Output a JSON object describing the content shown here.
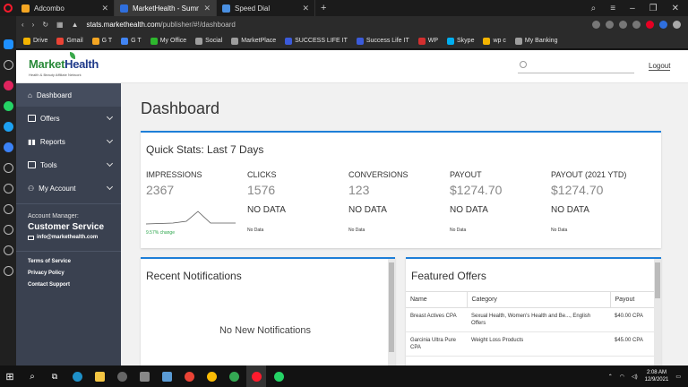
{
  "browser": {
    "tabs": [
      {
        "title": "Adcombo",
        "active": false,
        "color": "#f5a623"
      },
      {
        "title": "MarketHealth - Summary R",
        "active": true,
        "color": "#2f6fde"
      },
      {
        "title": "Speed Dial",
        "active": false,
        "color": "#4a90e2"
      }
    ],
    "url_host": "stats.markethealth.com",
    "url_path": "/publisher/#!/dashboard",
    "bookmarks": [
      {
        "label": "Drive",
        "color": "#f4b400"
      },
      {
        "label": "Gmail",
        "color": "#ea4335"
      },
      {
        "label": "G T",
        "color": "#f5a623"
      },
      {
        "label": "G T",
        "color": "#4285f4"
      },
      {
        "label": "My Office",
        "color": "#2eb82e"
      },
      {
        "label": "Social",
        "color": "#9e9e9e"
      },
      {
        "label": "MarketPlace",
        "color": "#9e9e9e"
      },
      {
        "label": "SUCCESS LIFE IT",
        "color": "#3b5bdb"
      },
      {
        "label": "Success Life IT",
        "color": "#3b5bdb"
      },
      {
        "label": "WP",
        "color": "#d32f2f"
      },
      {
        "label": "Skype",
        "color": "#00aff0"
      },
      {
        "label": "wp c",
        "color": "#f4b400"
      },
      {
        "label": "My Banking",
        "color": "#9e9e9e"
      }
    ]
  },
  "site": {
    "logo_a": "Market",
    "logo_b": "Health",
    "logo_tagline": "Health & Beauty Affiliate Network",
    "logout": "Logout"
  },
  "sidebar": {
    "items": [
      {
        "label": "Dashboard",
        "icon": "home-icon"
      },
      {
        "label": "Offers",
        "icon": "chat-icon"
      },
      {
        "label": "Reports",
        "icon": "bar-chart-icon"
      },
      {
        "label": "Tools",
        "icon": "tools-icon"
      },
      {
        "label": "My Account",
        "icon": "user-icon"
      }
    ],
    "account_manager_label": "Account Manager:",
    "account_manager_name": "Customer Service",
    "account_manager_email": "info@markethealth.com",
    "legal": [
      "Terms of Service",
      "Privacy Policy",
      "Contact Support"
    ]
  },
  "main": {
    "title": "Dashboard",
    "quick_stats": {
      "title": "Quick Stats: Last 7 Days",
      "stats": [
        {
          "label": "IMPRESSIONS",
          "value": "2367",
          "sub": "",
          "footer": "9.57% change"
        },
        {
          "label": "CLICKS",
          "value": "1576",
          "sub": "NO DATA",
          "footer": "No Data"
        },
        {
          "label": "CONVERSIONS",
          "value": "123",
          "sub": "NO DATA",
          "footer": "No Data"
        },
        {
          "label": "PAYOUT",
          "value": "$1274.70",
          "sub": "NO DATA",
          "footer": "No Data"
        },
        {
          "label": "PAYOUT (2021 YTD)",
          "value": "$1274.70",
          "sub": "NO DATA",
          "footer": "No Data"
        }
      ]
    },
    "notifications": {
      "title": "Recent Notifications",
      "empty": "No New Notifications"
    },
    "featured": {
      "title": "Featured Offers",
      "columns": [
        "Name",
        "Category",
        "Payout"
      ],
      "rows": [
        [
          "Breast Actives CPA",
          "Sexual Health, Women's Health and Be..., English Offers",
          "$40.00 CPA"
        ],
        [
          "Garcinia Ultra Pure CPA",
          "Weight Loss Products",
          "$45.00 CPA"
        ]
      ]
    }
  },
  "taskbar": {
    "time": "2:08 AM",
    "date": "12/9/2021"
  }
}
